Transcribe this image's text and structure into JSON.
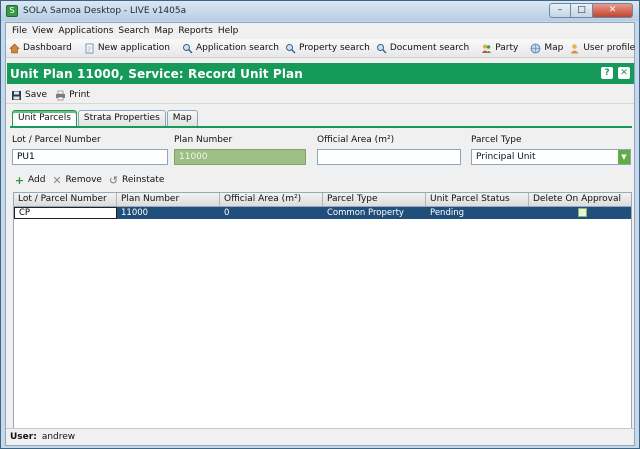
{
  "window": {
    "title": "SOLA Samoa Desktop - LIVE v1405a",
    "controls": {
      "minimize": "–",
      "maximize": "□",
      "close": "✕"
    }
  },
  "menu": [
    "File",
    "View",
    "Applications",
    "Search",
    "Map",
    "Reports",
    "Help"
  ],
  "toolbar": {
    "dashboard": "Dashboard",
    "new_application": "New application",
    "application_search": "Application search",
    "property_search": "Property search",
    "document_search": "Document search",
    "party": "Party",
    "map": "Map",
    "user_profile": "User profile"
  },
  "panel": {
    "title": "Unit Plan 11000, Service: Record Unit Plan",
    "help_icon": "?",
    "close_icon": "✕"
  },
  "actions": {
    "save": "Save",
    "print": "Print"
  },
  "tabs": [
    "Unit Parcels",
    "Strata Properties",
    "Map"
  ],
  "form": {
    "lot_label": "Lot / Parcel Number",
    "lot_value": "PU1",
    "plan_label": "Plan Number",
    "plan_value": "11000",
    "area_label": "Official Area (m²)",
    "area_value": "",
    "type_label": "Parcel Type",
    "type_value": "Principal Unit"
  },
  "grid_actions": {
    "add": "Add",
    "remove": "Remove",
    "reinstate": "Reinstate"
  },
  "grid": {
    "headers": [
      "Lot / Parcel Number",
      "Plan Number",
      "Official Area (m²)",
      "Parcel Type",
      "Unit Parcel Status",
      "Delete On Approval"
    ],
    "rows": [
      {
        "lot": "CP",
        "plan": "11000",
        "area": "0",
        "type": "Common Property",
        "status": "Pending",
        "delete_on_approval": false
      }
    ]
  },
  "status": {
    "label": "User:",
    "value": "andrew"
  },
  "colors": {
    "header_green": "#169a5a",
    "selected_row": "#1f4f7a",
    "disabled_field": "#9dbf83"
  }
}
